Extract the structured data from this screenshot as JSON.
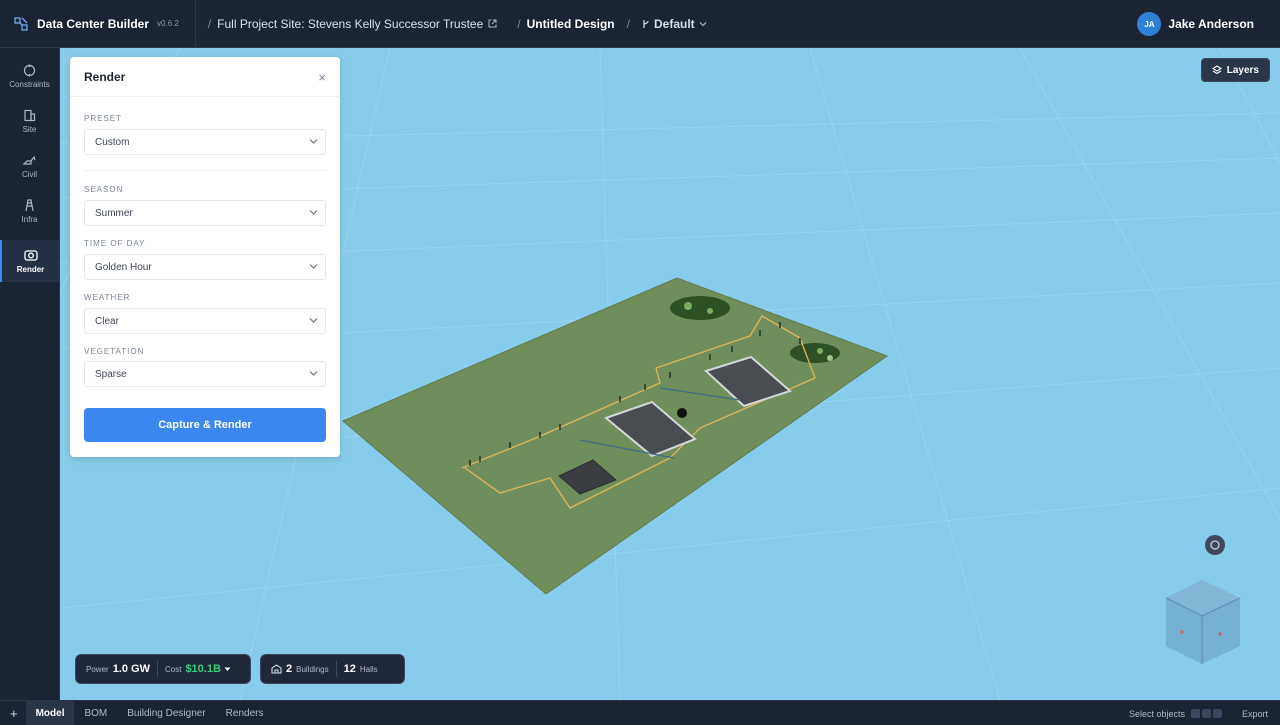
{
  "header": {
    "app_title": "Data Center Builder",
    "version": "v0.6.2",
    "project": "Full Project Site: Stevens Kelly Successor Trustee",
    "design": "Untitled Design",
    "branch": "Default",
    "user_initials": "JA",
    "user_name": "Jake Anderson"
  },
  "rail": {
    "items": [
      {
        "label": "Constraints",
        "icon": "target-icon"
      },
      {
        "label": "Site",
        "icon": "building-icon"
      },
      {
        "label": "Civil",
        "icon": "excavator-icon"
      },
      {
        "label": "Infra",
        "icon": "tower-icon"
      },
      {
        "label": "Render",
        "icon": "camera-icon",
        "active": true
      }
    ]
  },
  "viewport": {
    "layers_label": "Layers"
  },
  "render_panel": {
    "title": "Render",
    "close": "×",
    "preset_label": "PRESET",
    "preset_value": "Custom",
    "season_label": "SEASON",
    "season_value": "Summer",
    "time_label": "TIME OF DAY",
    "time_value": "Golden Hour",
    "weather_label": "WEATHER",
    "weather_value": "Clear",
    "vegetation_label": "VEGETATION",
    "vegetation_value": "Sparse",
    "capture_label": "Capture & Render"
  },
  "stats": {
    "power_label": "Power",
    "power_value": "1.0 GW",
    "cost_label": "Cost",
    "cost_value": "$10.1B",
    "buildings_value": "2",
    "buildings_label": "Buildings",
    "halls_value": "12",
    "halls_label": "Halls"
  },
  "bottom": {
    "add": "+",
    "tabs": [
      "Model",
      "BOM",
      "Building Designer",
      "Renders"
    ],
    "status": "Select objects",
    "export": "Export"
  },
  "colors": {
    "sky": "#87ccea",
    "ground": "#6f8e5c",
    "accent": "#3b86ef",
    "chrome": "#1b2433"
  }
}
